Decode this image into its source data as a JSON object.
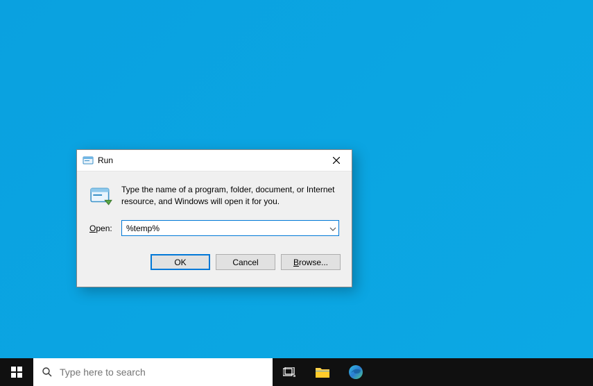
{
  "dialog": {
    "title": "Run",
    "info_text": "Type the name of a program, folder, document, or Internet resource, and Windows will open it for you.",
    "open_label": "Open:",
    "input_value": "%temp%",
    "buttons": {
      "ok": "OK",
      "cancel": "Cancel",
      "browse": "Browse..."
    }
  },
  "taskbar": {
    "search_placeholder": "Type here to search"
  }
}
